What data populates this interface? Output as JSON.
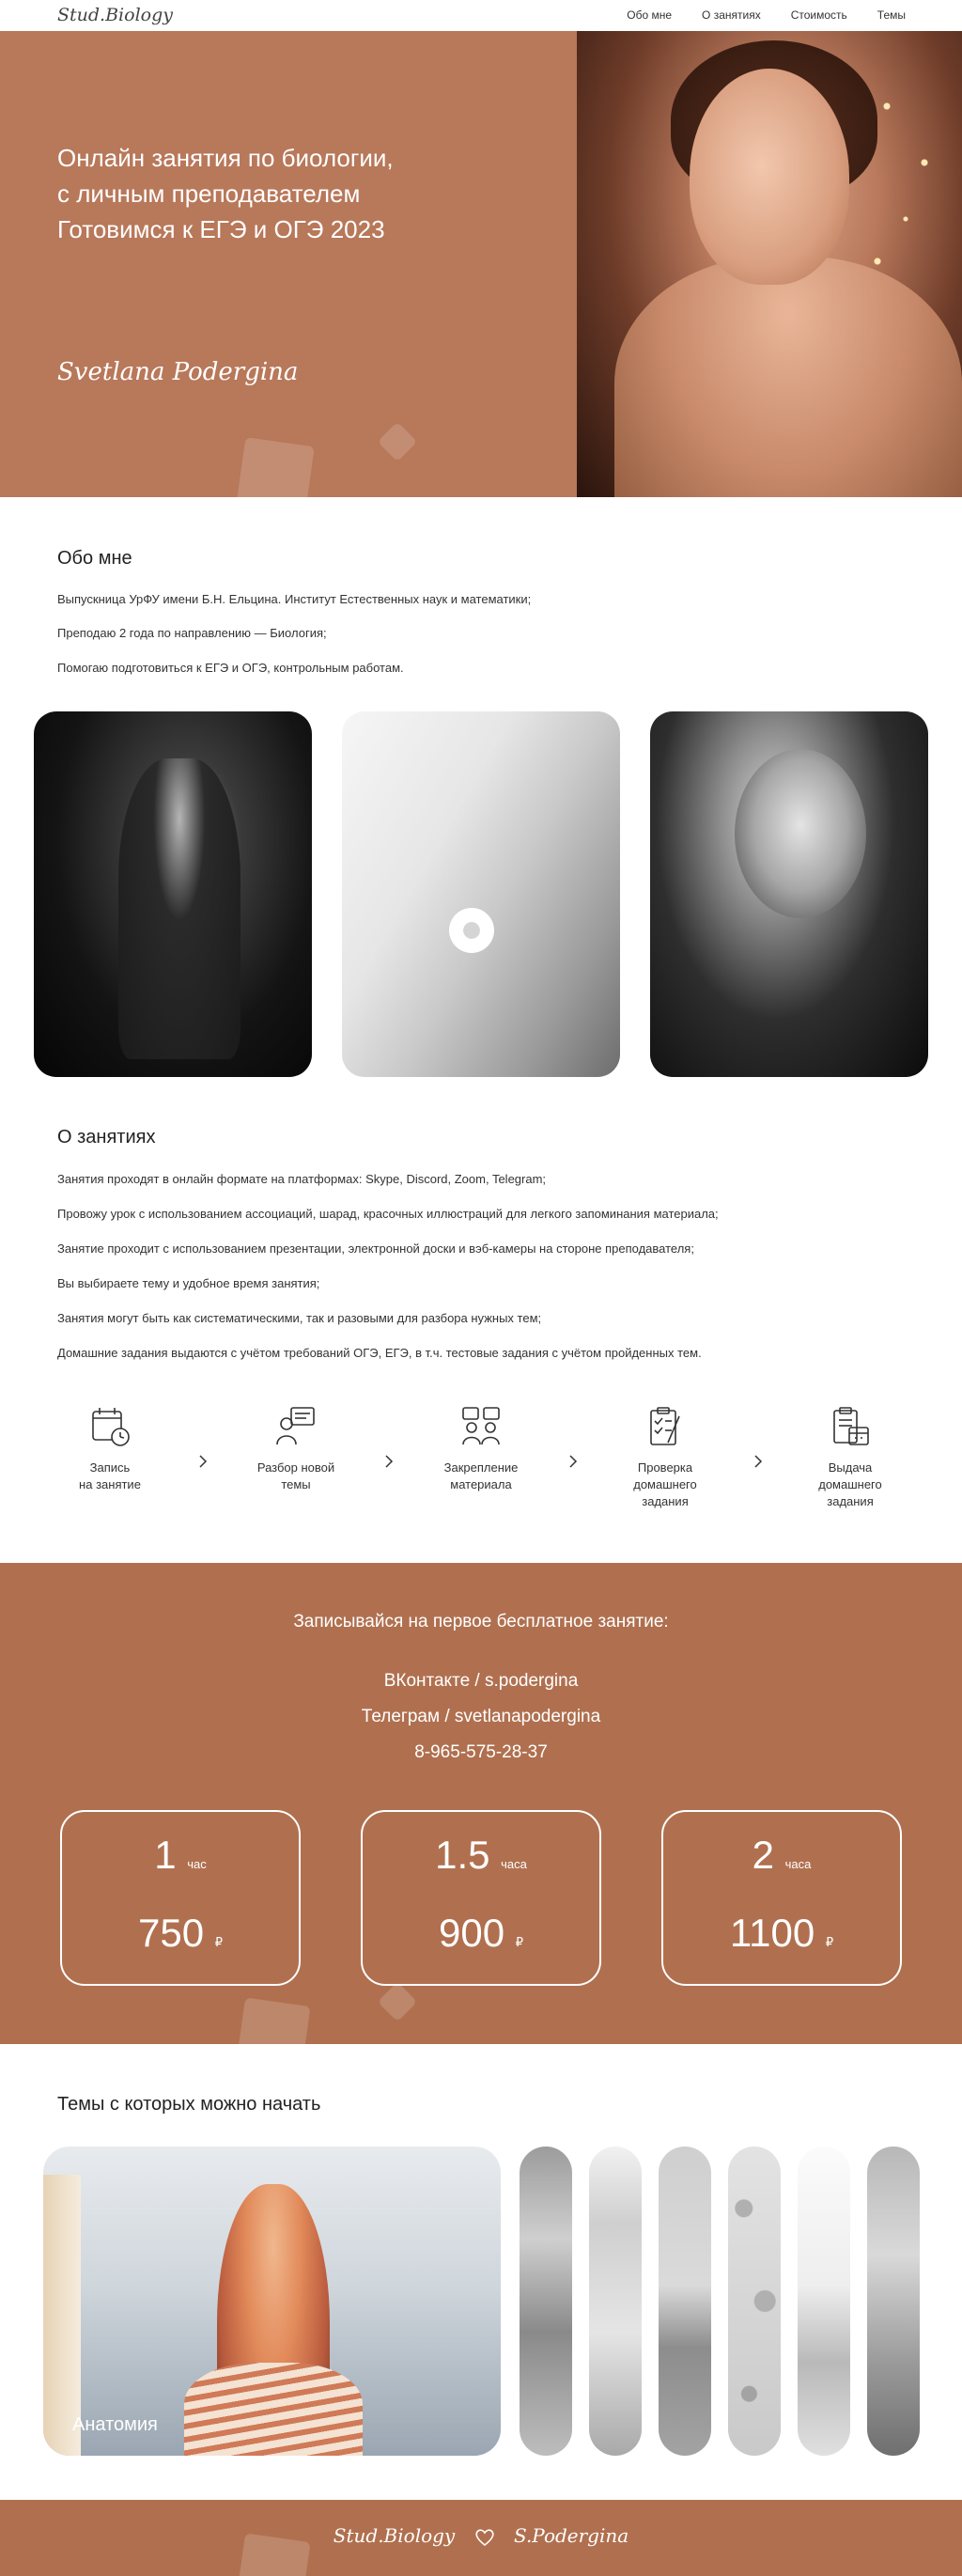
{
  "header": {
    "logo": "Stud.Biology",
    "menu": [
      "Обо мне",
      "О занятиях",
      "Стоимость",
      "Темы"
    ]
  },
  "hero": {
    "title_lines": [
      "Онлайн занятия по биологии,",
      "с личным преподавателем",
      "Готовимся к ЕГЭ и ОГЭ 2023"
    ],
    "signature": "Svetlana Podergina"
  },
  "about": {
    "title": "Обо мне",
    "lines": [
      "Выпускница УрФУ имени Б.Н. Ельцина. Институт Естественных наук и математики;",
      "Преподаю 2 года по направлению — Биология;",
      "Помогаю подготовиться к ЕГЭ и ОГЭ, контрольным работам."
    ]
  },
  "lessons": {
    "title": "О занятиях",
    "lines": [
      "Занятия проходят в онлайн формате на платформах: Skype, Discord, Zoom, Telegram;",
      "Провожу урок с использованием ассоциаций, шарад, красочных иллюстраций для легкого запоминания материала;",
      "Занятие проходит с использованием презентации, электронной доски и вэб-камеры на стороне преподавателя;",
      "Вы выбираете тему и удобное время занятия;",
      "Занятия могут быть как систематическими, так и разовыми для разбора нужных тем;",
      "Домашние задания выдаются с учётом требований ОГЭ, ЕГЭ, в т.ч. тестовые задания с учётом пройденных тем."
    ],
    "steps": [
      {
        "icon": "calendar-clock-icon",
        "lines": [
          "Запись",
          "на занятие"
        ]
      },
      {
        "icon": "teacher-board-icon",
        "lines": [
          "Разбор новой",
          "темы"
        ]
      },
      {
        "icon": "discussion-icon",
        "lines": [
          "Закрепление",
          "материала"
        ]
      },
      {
        "icon": "checklist-icon",
        "lines": [
          "Проверка",
          "домашнего",
          "задания"
        ]
      },
      {
        "icon": "homework-icon",
        "lines": [
          "Выдача",
          "домашнего",
          "задания"
        ]
      }
    ]
  },
  "contact": {
    "title": "Записывайся на первое бесплатное занятие:",
    "vk": "ВКонтакте / s.podergina",
    "telegram": "Телеграм / svetlanapodergina",
    "phone": "8-965-575-28-37"
  },
  "prices": [
    {
      "duration": "1",
      "unit": "час",
      "amount": "750",
      "currency": "₽"
    },
    {
      "duration": "1.5",
      "unit": "часа",
      "amount": "900",
      "currency": "₽"
    },
    {
      "duration": "2",
      "unit": "часа",
      "amount": "1100",
      "currency": "₽"
    }
  ],
  "topics": {
    "title": "Темы с которых можно начать",
    "active_label": "Анатомия"
  },
  "footer": {
    "left": "Stud.Biology",
    "right": "S.Podergina"
  },
  "colors": {
    "hero": "#b8785a",
    "accent": "#b0704f"
  }
}
